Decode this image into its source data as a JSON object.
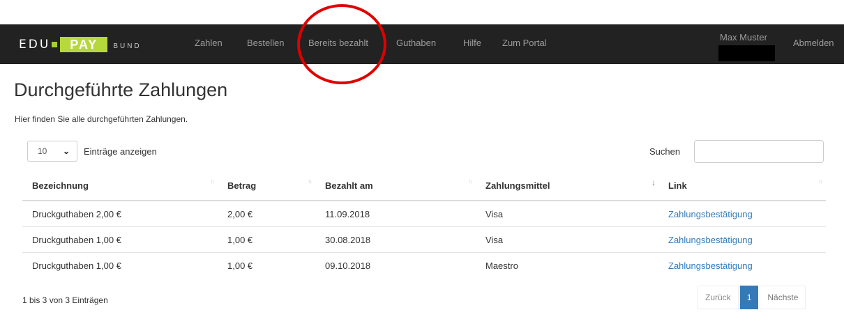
{
  "brand": {
    "edu": "EDU",
    "pay": "PAY",
    "bund": "BUND"
  },
  "nav": {
    "items": [
      "Zahlen",
      "Bestellen",
      "Bereits bezahlt",
      "Guthaben",
      "Hilfe",
      "Zum Portal"
    ],
    "user_name": "Max Muster",
    "logout": "Abmelden"
  },
  "page": {
    "title": "Durchgeführte Zahlungen",
    "subtitle": "Hier finden Sie alle durchgeführten Zahlungen."
  },
  "controls": {
    "page_length": "10",
    "length_label": "Einträge anzeigen",
    "search_label": "Suchen",
    "search_value": ""
  },
  "table": {
    "columns": [
      "Bezeichnung",
      "Betrag",
      "Bezahlt am",
      "Zahlungsmittel",
      "Link"
    ],
    "rows": [
      [
        "Druckguthaben 2,00 €",
        "2,00 €",
        "11.09.2018",
        "Visa",
        "Zahlungsbestätigung"
      ],
      [
        "Druckguthaben 1,00 €",
        "1,00 €",
        "30.08.2018",
        "Visa",
        "Zahlungsbestätigung"
      ],
      [
        "Druckguthaben 1,00 €",
        "1,00 €",
        "09.10.2018",
        "Maestro",
        "Zahlungsbestätigung"
      ]
    ]
  },
  "footer": {
    "info": "1 bis 3 von 3 Einträgen",
    "prev": "Zurück",
    "current_page": "1",
    "next": "Nächste"
  },
  "colors": {
    "navbar": "#222222",
    "brand_green": "#b6d83d",
    "link": "#337ab7",
    "annotation": "#e00000"
  },
  "icons": {
    "sort": "sort-both-icon",
    "sort_active": "sort-down-icon",
    "chevron": "chevron-down-icon"
  }
}
